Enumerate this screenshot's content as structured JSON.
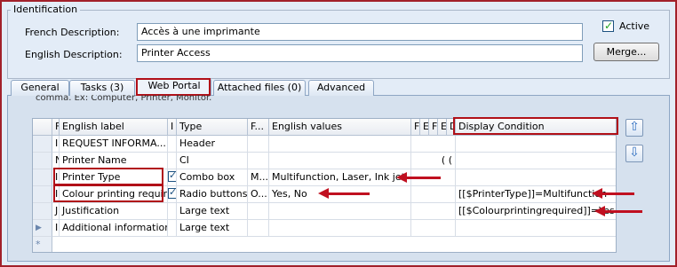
{
  "identification": {
    "title": "Identification",
    "french_label": "French Description:",
    "french_value": "Accès à une imprimante",
    "english_label": "English Description:",
    "english_value": "Printer Access",
    "active_label": "Active",
    "active_checked": true,
    "merge_label": "Merge..."
  },
  "tabs": [
    {
      "label": "General"
    },
    {
      "label": "Tasks (3)"
    },
    {
      "label": "Web Portal",
      "active": true
    },
    {
      "label": "Attached files (0)"
    },
    {
      "label": "Advanced"
    }
  ],
  "hint_text": "comma. Ex: Computer, Printer, Monitor.",
  "grid": {
    "headers": [
      "F",
      "English label",
      "I",
      "Type",
      "F...",
      "English values",
      "F",
      "E",
      "F",
      "E",
      "D",
      "Display Condition"
    ],
    "rows": [
      {
        "c0": "I",
        "label": "REQUEST INFORMA...",
        "cb": false,
        "type": "Header",
        "f": "",
        "values": "",
        "misc": "",
        "cond": ""
      },
      {
        "c0": "N",
        "label": "Printer Name",
        "cb": false,
        "type": "CI",
        "f": "",
        "values": "",
        "misc": "( (",
        "cond": ""
      },
      {
        "c0": "I",
        "label": "Printer Type",
        "cb": true,
        "type": "Combo box",
        "f": "M...",
        "values": "Multifunction, Laser, Ink jet",
        "misc": "",
        "cond": ""
      },
      {
        "c0": "I",
        "label": "Colour printing requir...",
        "cb": true,
        "type": "Radio buttons",
        "f": "O...",
        "values": "Yes, No",
        "misc": "",
        "cond": "[[$PrinterType]]=Multifunction"
      },
      {
        "c0": "J",
        "label": "Justification",
        "cb": false,
        "type": "Large text",
        "f": "",
        "values": "",
        "misc": "",
        "cond": "[[$Colourprintingrequired]]=Yes"
      },
      {
        "c0": "I",
        "label": "Additional information",
        "cb": false,
        "type": "Large text",
        "f": "",
        "values": "",
        "misc": "",
        "cond": ""
      }
    ]
  },
  "colors": {
    "highlight": "#b11018",
    "background": "#e3ecf7",
    "accent": "#2d6dbf"
  },
  "icons": {
    "move_up": "arrow-up-icon",
    "move_down": "arrow-down-icon"
  }
}
